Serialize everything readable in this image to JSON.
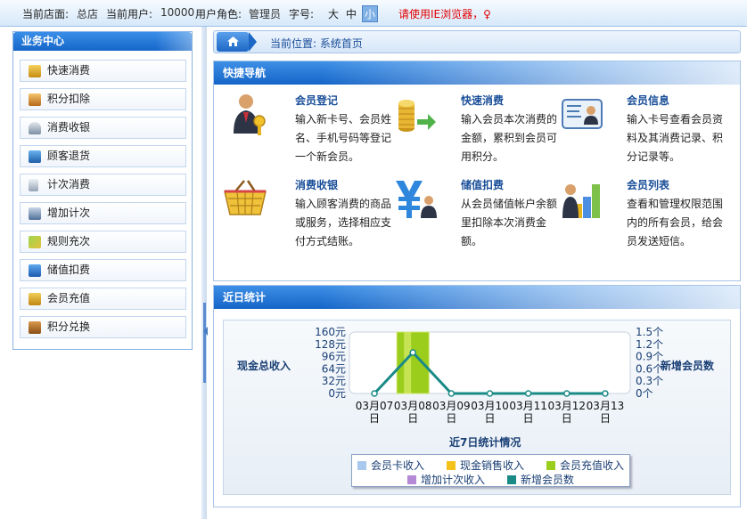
{
  "topbar": {
    "store_label": "当前店面:",
    "store_value": "总店",
    "user_label": "当前用户:",
    "user_value": "10000",
    "role_label": "用户角色:",
    "role_value": "管理员",
    "font_label": "字号:",
    "font_large": "大",
    "font_medium": "中",
    "font_small": "小",
    "warning": "请使用IE浏览器，♀"
  },
  "sidebar": {
    "title": "业务中心",
    "items": [
      {
        "label": "快速消费",
        "icon": "coins-icon"
      },
      {
        "label": "积分扣除",
        "icon": "points-deduct-icon"
      },
      {
        "label": "消费收银",
        "icon": "cashier-icon"
      },
      {
        "label": "顾客退货",
        "icon": "return-icon"
      },
      {
        "label": "计次消费",
        "icon": "count-consume-icon"
      },
      {
        "label": "增加计次",
        "icon": "add-count-icon"
      },
      {
        "label": "规则充次",
        "icon": "rule-recharge-icon"
      },
      {
        "label": "储值扣费",
        "icon": "yen-user-icon"
      },
      {
        "label": "会员充值",
        "icon": "member-recharge-icon"
      },
      {
        "label": "积分兑换",
        "icon": "exchange-icon"
      }
    ]
  },
  "breadcrumb": {
    "text": "当前位置: 系统首页"
  },
  "quick_nav": {
    "title": "快捷导航",
    "items": [
      {
        "title": "会员登记",
        "desc": "输入新卡号、会员姓名、手机号码等登记一个新会员。",
        "icon": "member-register-icon"
      },
      {
        "title": "快速消费",
        "desc": "输入会员本次消费的金额，累积到会员可用积分。",
        "icon": "quick-consume-icon"
      },
      {
        "title": "会员信息",
        "desc": "输入卡号查看会员资料及其消费记录、积分记录等。",
        "icon": "member-info-icon"
      },
      {
        "title": "消费收银",
        "desc": "输入顾客消费的商品或服务，选择相应支付方式结账。",
        "icon": "shopping-basket-icon"
      },
      {
        "title": "储值扣费",
        "desc": "从会员储值帐户余额里扣除本次消费金额。",
        "icon": "stored-value-icon"
      },
      {
        "title": "会员列表",
        "desc": "查看和管理权限范围内的所有会员，给会员发送短信。",
        "icon": "member-list-icon"
      }
    ]
  },
  "stats": {
    "title": "近日统计",
    "left_axis_title": "现金总收入",
    "right_axis_title": "新增会员数",
    "caption": "近7日统计情况",
    "legend": [
      {
        "label": "会员卡收入",
        "color": "#a9c8ee"
      },
      {
        "label": "现金销售收入",
        "color": "#f5c21b"
      },
      {
        "label": "会员充值收入",
        "color": "#9acd1c"
      },
      {
        "label": "增加计次收入",
        "color": "#b48ad6"
      },
      {
        "label": "新增会员数",
        "color": "#1a8a86"
      }
    ]
  },
  "chart_data": {
    "type": "bar",
    "categories": [
      "03月07日",
      "03月08日",
      "03月09日",
      "03月10日",
      "03月11日",
      "03月12日",
      "03月13日"
    ],
    "y_left_ticks": [
      "160元",
      "128元",
      "96元",
      "64元",
      "32元",
      "0元"
    ],
    "y_left_range": [
      0,
      160
    ],
    "y_right_ticks": [
      "1.5个",
      "1.2个",
      "0.9个",
      "0.6个",
      "0.3个",
      "0个"
    ],
    "y_right_range": [
      0,
      1.5
    ],
    "series": [
      {
        "name": "会员卡收入",
        "axis": "left",
        "values": [
          0,
          0,
          0,
          0,
          0,
          0,
          0
        ]
      },
      {
        "name": "现金销售收入",
        "axis": "left",
        "values": [
          0,
          0,
          0,
          0,
          0,
          0,
          0
        ]
      },
      {
        "name": "会员充值收入",
        "axis": "left",
        "values": [
          0,
          160,
          0,
          0,
          0,
          0,
          0
        ]
      },
      {
        "name": "增加计次收入",
        "axis": "left",
        "values": [
          0,
          0,
          0,
          0,
          0,
          0,
          0
        ]
      },
      {
        "name": "新增会员数",
        "axis": "right",
        "type": "line",
        "values": [
          0,
          1,
          0,
          0,
          0,
          0,
          0
        ]
      }
    ],
    "xlabel": "近7日统计情况",
    "ylabel_left": "现金总收入",
    "ylabel_right": "新增会员数",
    "legend_position": "bottom"
  }
}
